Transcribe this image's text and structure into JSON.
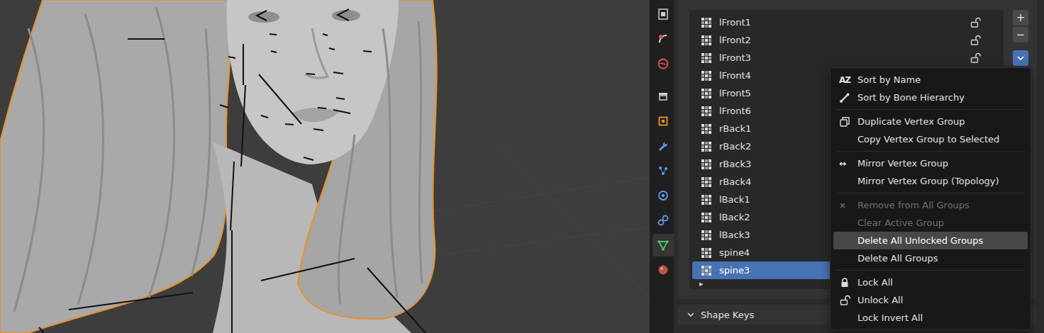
{
  "viewport": {
    "kind": "3d-sculpt-with-bones"
  },
  "property_tabs": [
    {
      "selected": false
    },
    {
      "selected": false
    },
    {
      "selected": false
    },
    {
      "selected": false
    },
    {
      "selected": false
    },
    {
      "selected": false
    },
    {
      "selected": false
    },
    {
      "selected": false
    },
    {
      "selected": false
    },
    {
      "selected": true
    },
    {
      "selected": false
    }
  ],
  "vertex_groups": [
    {
      "name": "lFront1",
      "locked": false,
      "selected": false
    },
    {
      "name": "lFront2",
      "locked": false,
      "selected": false
    },
    {
      "name": "lFront3",
      "locked": false,
      "selected": false
    },
    {
      "name": "lFront4",
      "locked": false,
      "selected": false
    },
    {
      "name": "lFront5",
      "locked": false,
      "selected": false
    },
    {
      "name": "lFront6",
      "locked": false,
      "selected": false
    },
    {
      "name": "rBack1",
      "locked": false,
      "selected": false
    },
    {
      "name": "rBack2",
      "locked": false,
      "selected": false
    },
    {
      "name": "rBack3",
      "locked": false,
      "selected": false
    },
    {
      "name": "rBack4",
      "locked": false,
      "selected": false
    },
    {
      "name": "lBack1",
      "locked": false,
      "selected": false
    },
    {
      "name": "lBack2",
      "locked": false,
      "selected": false
    },
    {
      "name": "lBack3",
      "locked": false,
      "selected": false
    },
    {
      "name": "spine4",
      "locked": false,
      "selected": false
    },
    {
      "name": "spine3",
      "locked": false,
      "selected": true
    }
  ],
  "list_filter_toggle": "▸",
  "list_buttons": {
    "add": "+",
    "remove": "−",
    "specials_open": true
  },
  "context_menu": {
    "sections": [
      [
        {
          "label": "Sort by Name",
          "icon_text": "AZ",
          "disabled": false,
          "selected": false
        },
        {
          "label": "Sort by Bone Hierarchy",
          "icon_text": "",
          "disabled": false,
          "selected": false
        }
      ],
      [
        {
          "label": "Duplicate Vertex Group",
          "icon_text": "",
          "disabled": false,
          "selected": false
        },
        {
          "label": "Copy Vertex Group to Selected",
          "icon_text": "",
          "disabled": false,
          "selected": false
        }
      ],
      [
        {
          "label": "Mirror Vertex Group",
          "icon_text": "↔",
          "disabled": false,
          "selected": false
        },
        {
          "label": "Mirror Vertex Group (Topology)",
          "icon_text": "",
          "disabled": false,
          "selected": false
        }
      ],
      [
        {
          "label": "Remove from All Groups",
          "icon_text": "×",
          "disabled": true,
          "selected": false
        },
        {
          "label": "Clear Active Group",
          "icon_text": "",
          "disabled": true,
          "selected": false
        },
        {
          "label": "Delete All Unlocked Groups",
          "icon_text": "",
          "disabled": false,
          "selected": true
        },
        {
          "label": "Delete All Groups",
          "icon_text": "",
          "disabled": false,
          "selected": false
        }
      ],
      [
        {
          "label": "Lock All",
          "icon_text": "",
          "disabled": false,
          "selected": false
        },
        {
          "label": "Unlock All",
          "icon_text": "",
          "disabled": false,
          "selected": false
        },
        {
          "label": "Lock Invert All",
          "icon_text": "",
          "disabled": false,
          "selected": false
        }
      ]
    ]
  },
  "shape_keys_panel": {
    "title": "Shape Keys",
    "expanded": true
  }
}
